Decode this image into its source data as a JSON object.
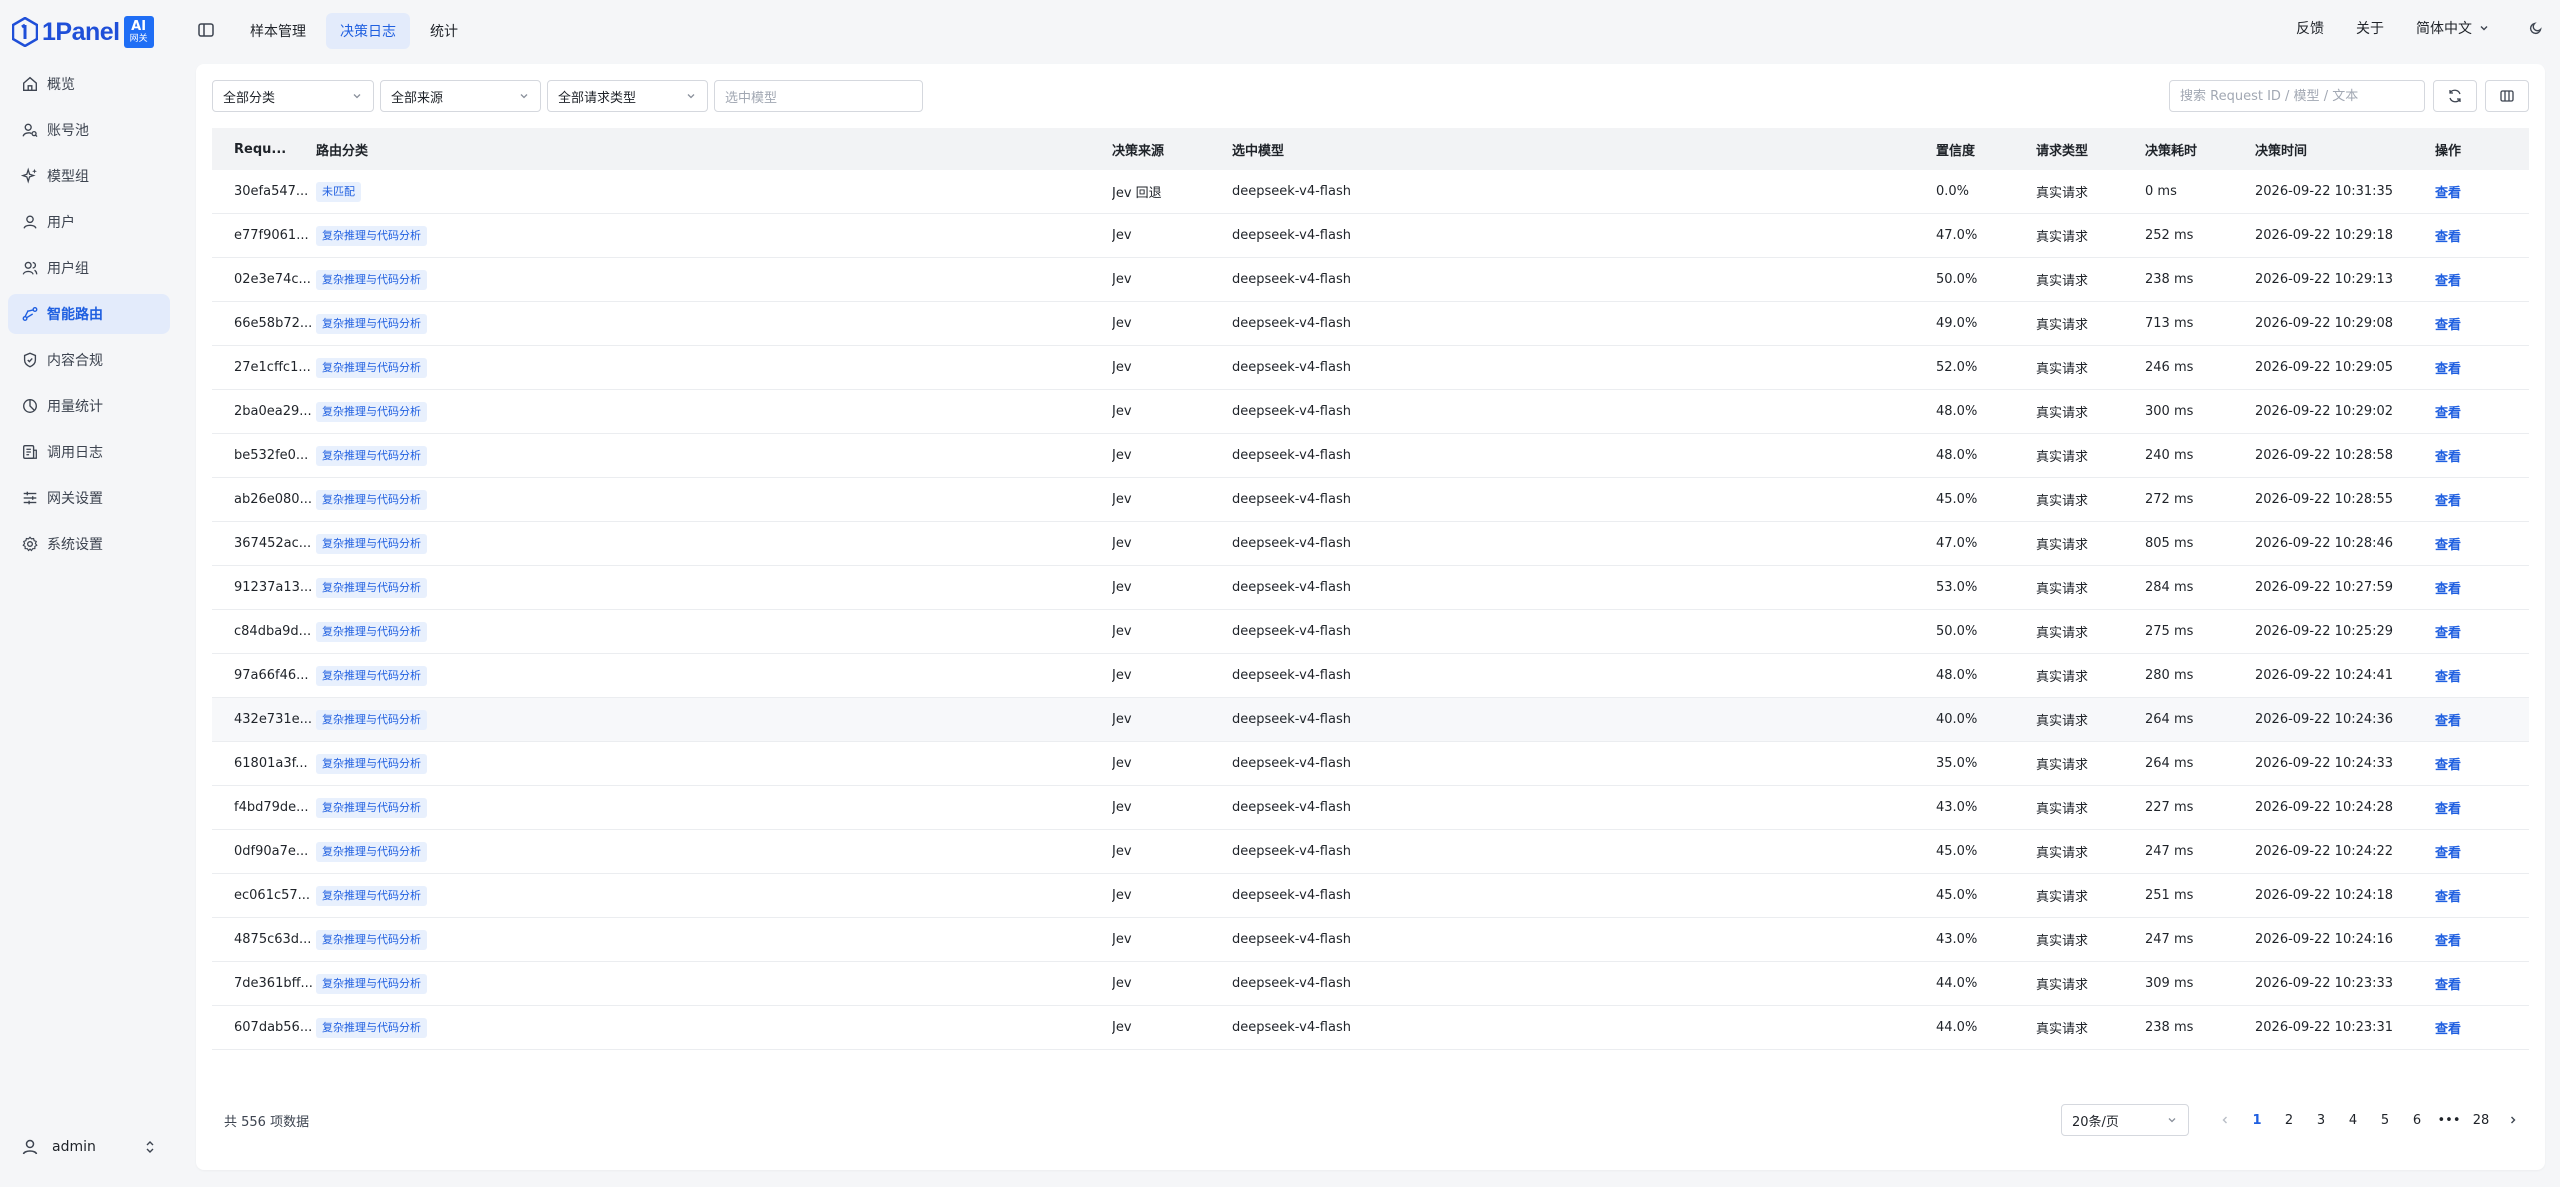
{
  "app": {
    "logo_text": "1Panel",
    "logo_badge_line1": "AI",
    "logo_badge_line2": "网关"
  },
  "sidebar": {
    "items": [
      {
        "label": "概览",
        "icon": "home-icon"
      },
      {
        "label": "账号池",
        "icon": "user-search-icon"
      },
      {
        "label": "模型组",
        "icon": "sparkles-icon"
      },
      {
        "label": "用户",
        "icon": "user-icon"
      },
      {
        "label": "用户组",
        "icon": "users-icon"
      },
      {
        "label": "智能路由",
        "icon": "route-icon",
        "active": true
      },
      {
        "label": "内容合规",
        "icon": "shield-icon"
      },
      {
        "label": "用量统计",
        "icon": "pie-chart-icon"
      },
      {
        "label": "调用日志",
        "icon": "log-icon"
      },
      {
        "label": "网关设置",
        "icon": "sliders-icon"
      },
      {
        "label": "系统设置",
        "icon": "settings-icon"
      }
    ],
    "user": {
      "name": "admin"
    }
  },
  "header": {
    "tabs": [
      {
        "label": "样本管理"
      },
      {
        "label": "决策日志",
        "active": true
      },
      {
        "label": "统计"
      }
    ],
    "feedback": "反馈",
    "about": "关于",
    "language": "简体中文"
  },
  "filters": {
    "category": "全部分类",
    "source": "全部来源",
    "request_type": "全部请求类型",
    "model_placeholder": "选中模型",
    "search_placeholder": "搜索 Request ID / 模型 / 文本"
  },
  "table": {
    "columns": {
      "id": "Requ...",
      "category": "路由分类",
      "source": "决策来源",
      "model": "选中模型",
      "confidence": "置信度",
      "type": "请求类型",
      "duration": "决策耗时",
      "time": "决策时间",
      "op": "操作"
    },
    "rows": [
      {
        "id": "30efa547...",
        "category": "未匹配",
        "source": "Jev 回退",
        "model": "deepseek-v4-flash",
        "confidence": "0.0%",
        "type": "真实请求",
        "duration": "0 ms",
        "time": "2026-09-22 10:31:35",
        "op": "查看"
      },
      {
        "id": "e77f9061...",
        "category": "复杂推理与代码分析",
        "source": "Jev",
        "model": "deepseek-v4-flash",
        "confidence": "47.0%",
        "type": "真实请求",
        "duration": "252 ms",
        "time": "2026-09-22 10:29:18",
        "op": "查看"
      },
      {
        "id": "02e3e74c...",
        "category": "复杂推理与代码分析",
        "source": "Jev",
        "model": "deepseek-v4-flash",
        "confidence": "50.0%",
        "type": "真实请求",
        "duration": "238 ms",
        "time": "2026-09-22 10:29:13",
        "op": "查看"
      },
      {
        "id": "66e58b72...",
        "category": "复杂推理与代码分析",
        "source": "Jev",
        "model": "deepseek-v4-flash",
        "confidence": "49.0%",
        "type": "真实请求",
        "duration": "713 ms",
        "time": "2026-09-22 10:29:08",
        "op": "查看"
      },
      {
        "id": "27e1cffc1...",
        "category": "复杂推理与代码分析",
        "source": "Jev",
        "model": "deepseek-v4-flash",
        "confidence": "52.0%",
        "type": "真实请求",
        "duration": "246 ms",
        "time": "2026-09-22 10:29:05",
        "op": "查看"
      },
      {
        "id": "2ba0ea29...",
        "category": "复杂推理与代码分析",
        "source": "Jev",
        "model": "deepseek-v4-flash",
        "confidence": "48.0%",
        "type": "真实请求",
        "duration": "300 ms",
        "time": "2026-09-22 10:29:02",
        "op": "查看"
      },
      {
        "id": "be532fe0...",
        "category": "复杂推理与代码分析",
        "source": "Jev",
        "model": "deepseek-v4-flash",
        "confidence": "48.0%",
        "type": "真实请求",
        "duration": "240 ms",
        "time": "2026-09-22 10:28:58",
        "op": "查看"
      },
      {
        "id": "ab26e080...",
        "category": "复杂推理与代码分析",
        "source": "Jev",
        "model": "deepseek-v4-flash",
        "confidence": "45.0%",
        "type": "真实请求",
        "duration": "272 ms",
        "time": "2026-09-22 10:28:55",
        "op": "查看"
      },
      {
        "id": "367452ac...",
        "category": "复杂推理与代码分析",
        "source": "Jev",
        "model": "deepseek-v4-flash",
        "confidence": "47.0%",
        "type": "真实请求",
        "duration": "805 ms",
        "time": "2026-09-22 10:28:46",
        "op": "查看"
      },
      {
        "id": "91237a13...",
        "category": "复杂推理与代码分析",
        "source": "Jev",
        "model": "deepseek-v4-flash",
        "confidence": "53.0%",
        "type": "真实请求",
        "duration": "284 ms",
        "time": "2026-09-22 10:27:59",
        "op": "查看"
      },
      {
        "id": "c84dba9d...",
        "category": "复杂推理与代码分析",
        "source": "Jev",
        "model": "deepseek-v4-flash",
        "confidence": "50.0%",
        "type": "真实请求",
        "duration": "275 ms",
        "time": "2026-09-22 10:25:29",
        "op": "查看"
      },
      {
        "id": "97a66f46...",
        "category": "复杂推理与代码分析",
        "source": "Jev",
        "model": "deepseek-v4-flash",
        "confidence": "48.0%",
        "type": "真实请求",
        "duration": "280 ms",
        "time": "2026-09-22 10:24:41",
        "op": "查看"
      },
      {
        "id": "432e731e...",
        "category": "复杂推理与代码分析",
        "source": "Jev",
        "model": "deepseek-v4-flash",
        "confidence": "40.0%",
        "type": "真实请求",
        "duration": "264 ms",
        "time": "2026-09-22 10:24:36",
        "op": "查看",
        "hover": true
      },
      {
        "id": "61801a3f...",
        "category": "复杂推理与代码分析",
        "source": "Jev",
        "model": "deepseek-v4-flash",
        "confidence": "35.0%",
        "type": "真实请求",
        "duration": "264 ms",
        "time": "2026-09-22 10:24:33",
        "op": "查看"
      },
      {
        "id": "f4bd79de...",
        "category": "复杂推理与代码分析",
        "source": "Jev",
        "model": "deepseek-v4-flash",
        "confidence": "43.0%",
        "type": "真实请求",
        "duration": "227 ms",
        "time": "2026-09-22 10:24:28",
        "op": "查看"
      },
      {
        "id": "0df90a7e...",
        "category": "复杂推理与代码分析",
        "source": "Jev",
        "model": "deepseek-v4-flash",
        "confidence": "45.0%",
        "type": "真实请求",
        "duration": "247 ms",
        "time": "2026-09-22 10:24:22",
        "op": "查看"
      },
      {
        "id": "ec061c57...",
        "category": "复杂推理与代码分析",
        "source": "Jev",
        "model": "deepseek-v4-flash",
        "confidence": "45.0%",
        "type": "真实请求",
        "duration": "251 ms",
        "time": "2026-09-22 10:24:18",
        "op": "查看"
      },
      {
        "id": "4875c63d...",
        "category": "复杂推理与代码分析",
        "source": "Jev",
        "model": "deepseek-v4-flash",
        "confidence": "43.0%",
        "type": "真实请求",
        "duration": "247 ms",
        "time": "2026-09-22 10:24:16",
        "op": "查看"
      },
      {
        "id": "7de361bff...",
        "category": "复杂推理与代码分析",
        "source": "Jev",
        "model": "deepseek-v4-flash",
        "confidence": "44.0%",
        "type": "真实请求",
        "duration": "309 ms",
        "time": "2026-09-22 10:23:33",
        "op": "查看"
      },
      {
        "id": "607dab56...",
        "category": "复杂推理与代码分析",
        "source": "Jev",
        "model": "deepseek-v4-flash",
        "confidence": "44.0%",
        "type": "真实请求",
        "duration": "238 ms",
        "time": "2026-09-22 10:23:31",
        "op": "查看"
      }
    ]
  },
  "footer": {
    "total": "共 556 项数据",
    "page_size": "20条/页",
    "pages": [
      "1",
      "2",
      "3",
      "4",
      "5",
      "6",
      "•••",
      "28"
    ],
    "current_page": "1"
  },
  "colors": {
    "accent": "#1f5fe0",
    "tag_bg": "#e8f0fd",
    "sidebar_active_bg": "#e3ebfb"
  }
}
